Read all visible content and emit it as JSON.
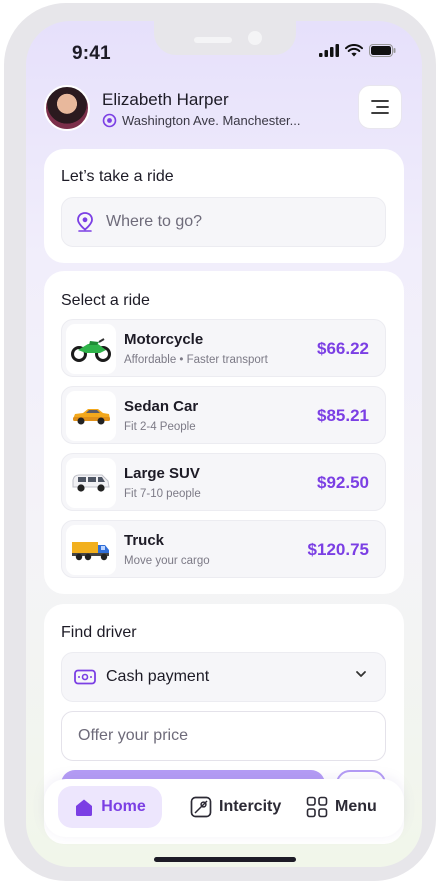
{
  "status_bar": {
    "time": "9:41"
  },
  "user": {
    "name": "Elizabeth Harper",
    "location": "Washington Ave. Manchester..."
  },
  "ride_request": {
    "title": "Let’s take a ride",
    "destination_placeholder": "Where to go?"
  },
  "select_ride": {
    "title": "Select a ride",
    "options": [
      {
        "name": "Motorcycle",
        "subtitle": "Affordable • Faster transport",
        "price": "$66.22",
        "icon": "motorcycle-icon"
      },
      {
        "name": "Sedan Car",
        "subtitle": "Fit 2-4 People",
        "price": "$85.21",
        "icon": "sedan-car-icon"
      },
      {
        "name": "Large SUV",
        "subtitle": "Fit 7-10 people",
        "price": "$92.50",
        "icon": "suv-icon"
      },
      {
        "name": "Truck",
        "subtitle": "Move your cargo",
        "price": "$120.75",
        "icon": "truck-icon"
      }
    ]
  },
  "find_driver": {
    "title": "Find driver",
    "payment_method": "Cash payment",
    "price_placeholder": "Offer your price"
  },
  "bottom_nav": {
    "home": "Home",
    "intercity": "Intercity",
    "menu": "Menu"
  },
  "colors": {
    "accent": "#7b3fe4",
    "accent_light": "#ede6fd",
    "card_bg": "#ffffff",
    "field_bg": "#f6f6f9"
  }
}
